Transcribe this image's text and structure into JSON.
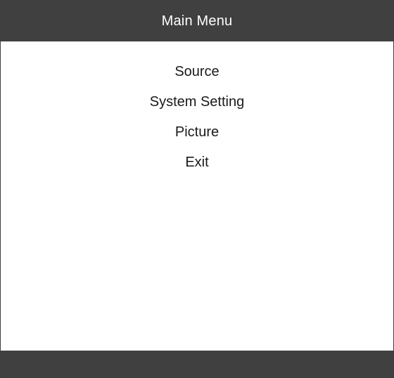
{
  "header": {
    "title": "Main Menu"
  },
  "menu": {
    "items": [
      {
        "label": "Source"
      },
      {
        "label": "System Setting"
      },
      {
        "label": "Picture"
      },
      {
        "label": "Exit"
      }
    ]
  },
  "colors": {
    "bar": "#404040",
    "background": "#ffffff",
    "text": "#1a1a1a",
    "header_text": "#ffffff"
  }
}
